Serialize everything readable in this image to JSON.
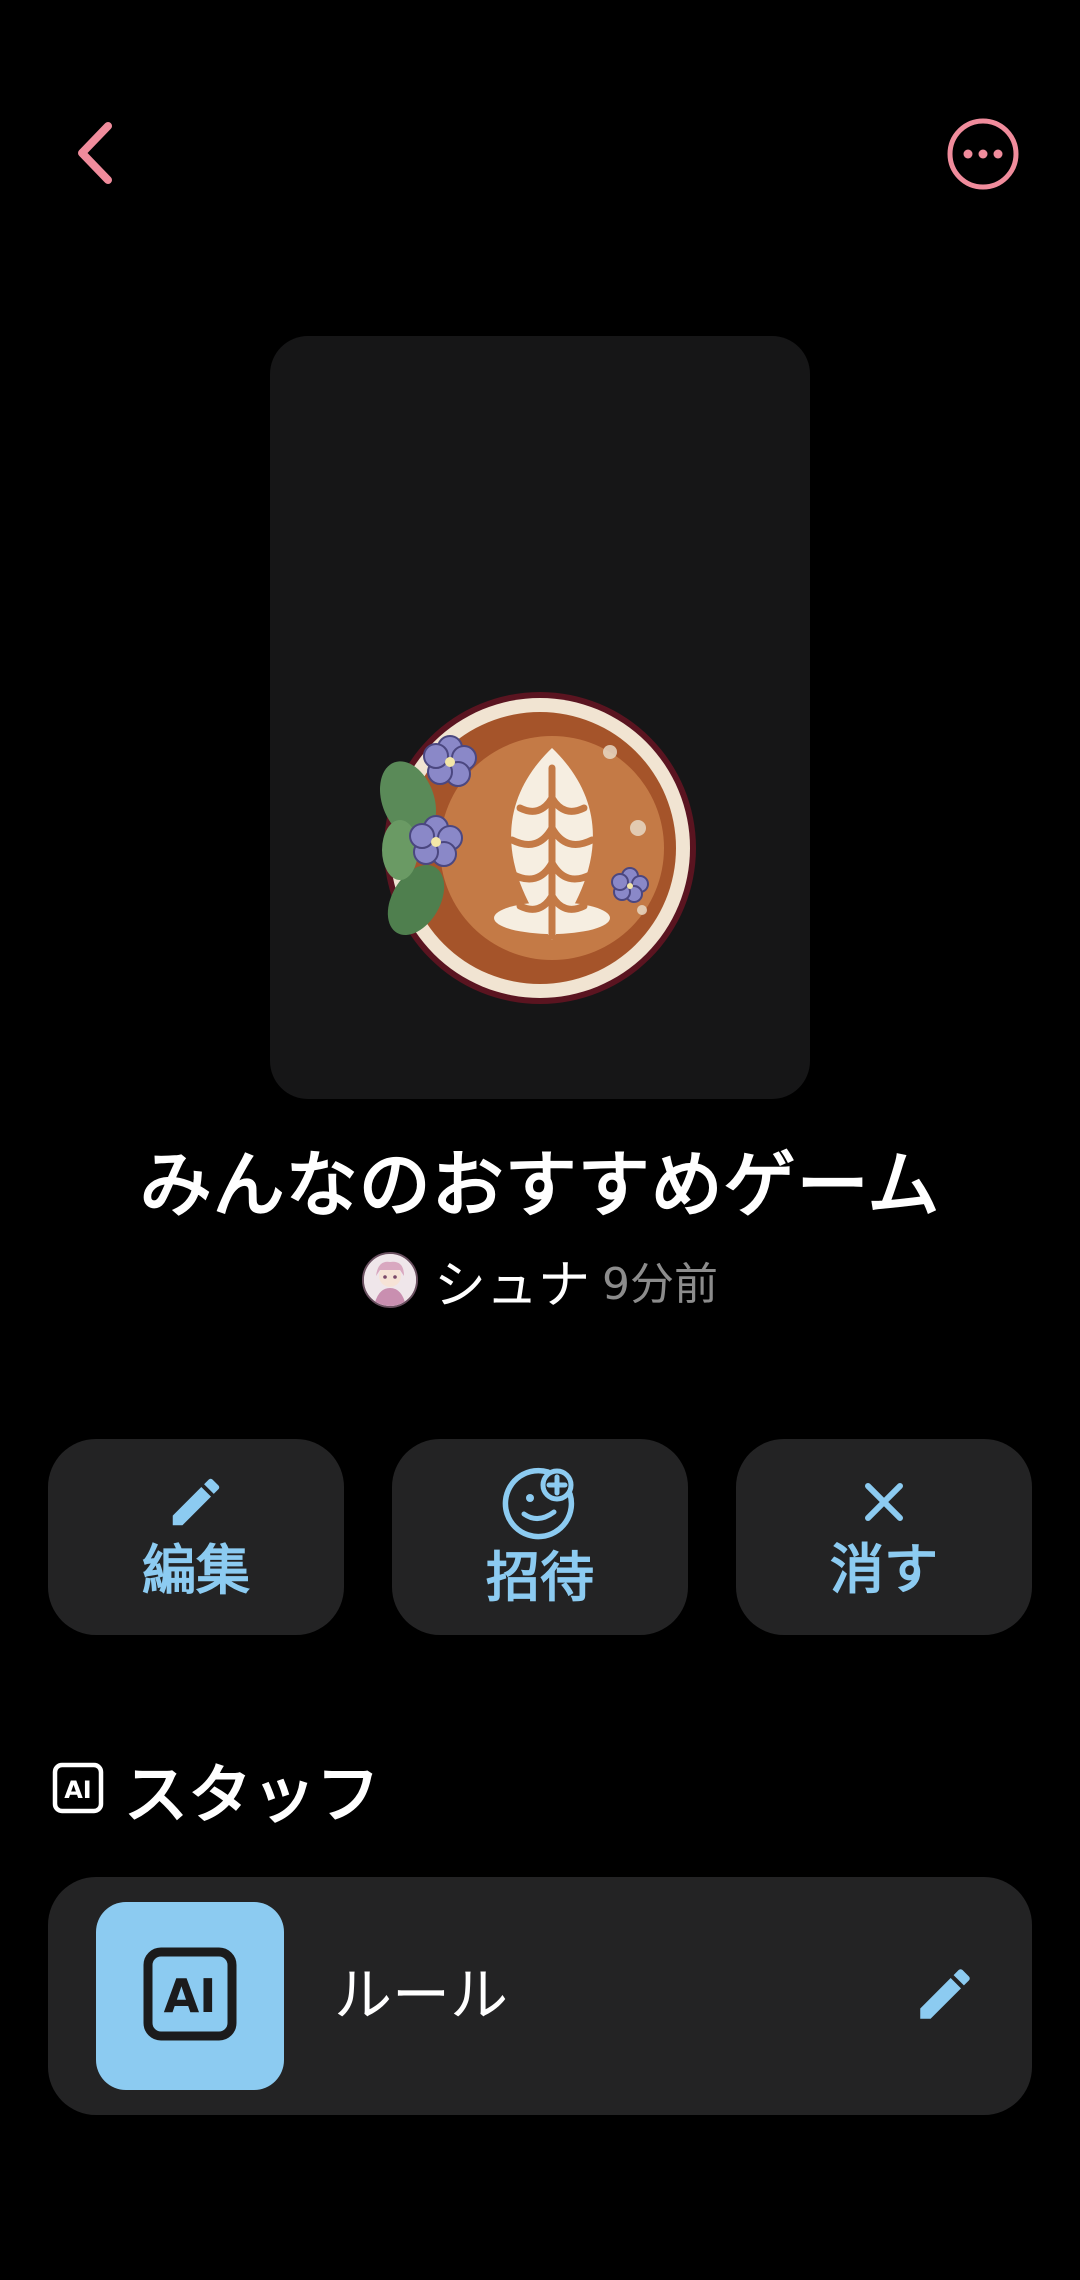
{
  "header": {
    "back_icon": "chevron-left-icon",
    "more_icon": "more-horizontal-icon",
    "accent_color": "#f08c9c"
  },
  "room": {
    "title": "みんなのおすすめゲーム",
    "author": "シュナ",
    "time": "9分前"
  },
  "actions": [
    {
      "label": "編集",
      "icon": "pencil-icon"
    },
    {
      "label": "招待",
      "icon": "person-add-icon"
    },
    {
      "label": "消す",
      "icon": "close-icon"
    }
  ],
  "staff": {
    "section_label": "スタッフ",
    "section_icon": "ai-icon",
    "items": [
      {
        "name": "ルール",
        "icon": "ai-icon",
        "edit_icon": "pencil-icon"
      }
    ]
  },
  "colors": {
    "action_color": "#8ccbf1",
    "card_bg": "#232324",
    "cover_bg": "#161617"
  }
}
